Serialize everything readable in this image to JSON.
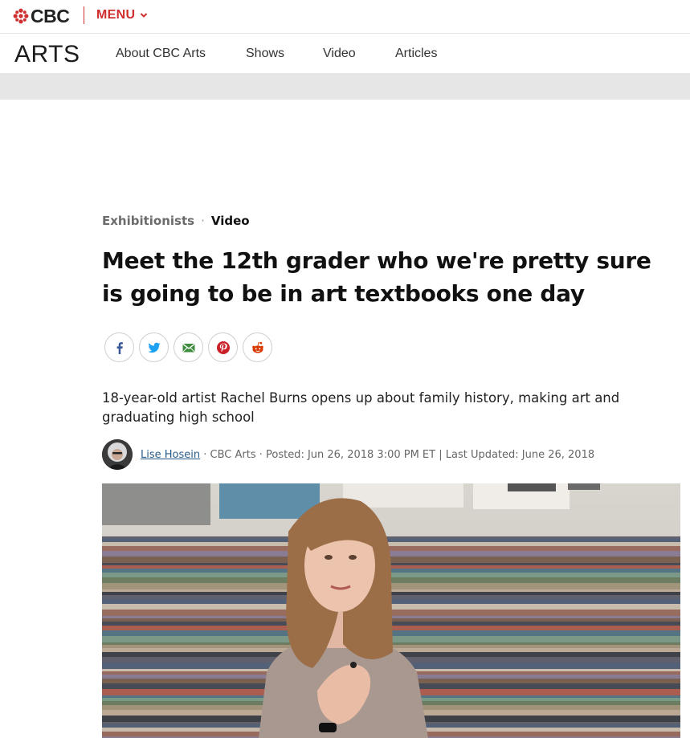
{
  "top_bar": {
    "logo_text": "CBC",
    "menu_label": "MENU",
    "brand_color": "#d02f2f"
  },
  "arts_nav": {
    "section_title": "ARTS",
    "items": [
      "About CBC Arts",
      "Shows",
      "Video",
      "Articles"
    ]
  },
  "article": {
    "breadcrumb": {
      "section": "Exhibitionists",
      "separator": "·",
      "type": "Video"
    },
    "headline": "Meet the 12th grader who we're pretty sure is going to be in art textbooks one day",
    "share_icons": [
      "facebook-icon",
      "twitter-icon",
      "email-icon",
      "pinterest-icon",
      "reddit-icon"
    ],
    "deck": "18-year-old artist Rachel Burns opens up about family history, making art and graduating high school",
    "byline": {
      "author": "Lise Hosein",
      "rest": " · CBC Arts · Posted: Jun 26, 2018 3:00 PM ET | Last Updated: June 26, 2018"
    }
  }
}
